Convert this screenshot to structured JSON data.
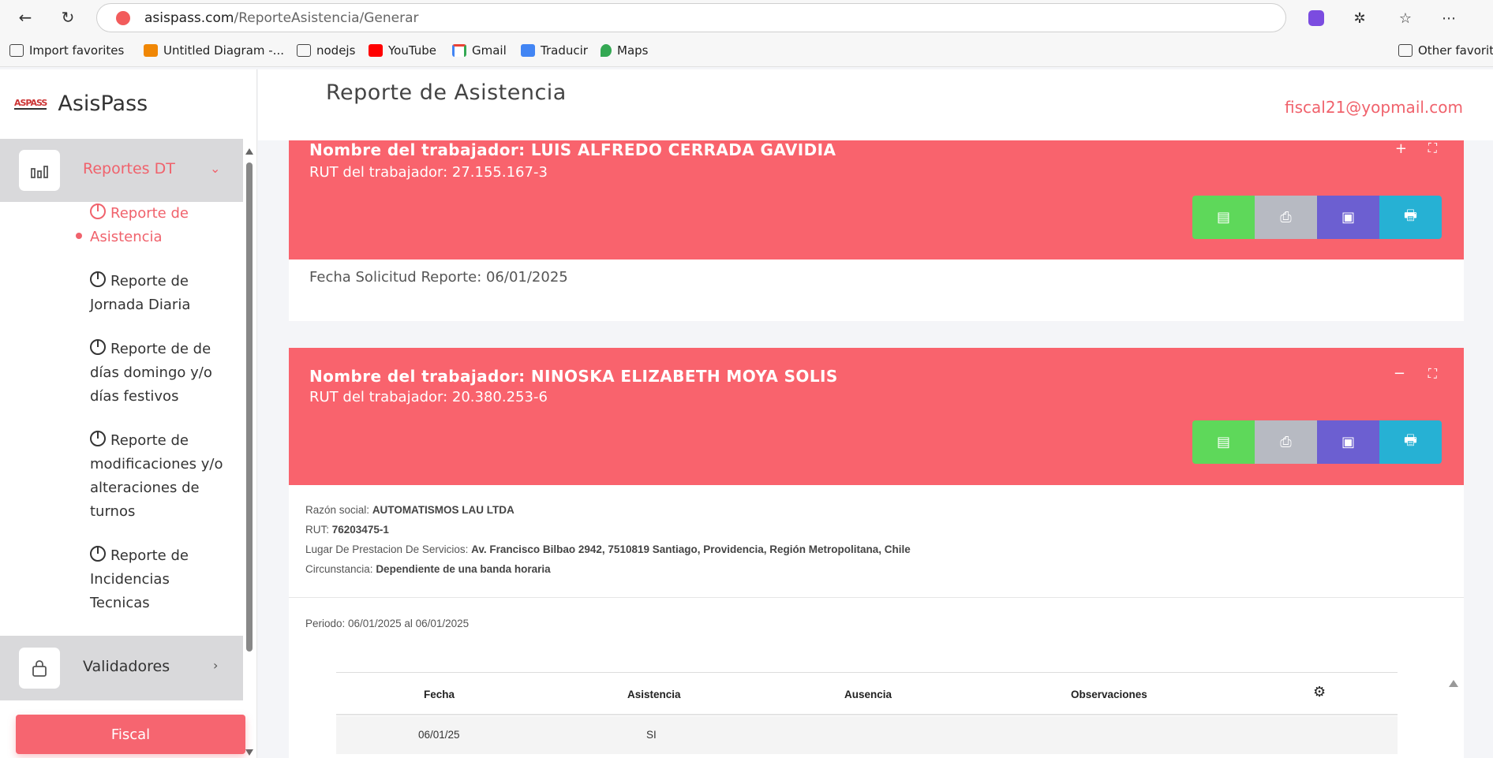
{
  "browser": {
    "url_host": "asispass.com",
    "url_path": "/ReporteAsistencia/Generar",
    "bookmarks": [
      "Import favorites",
      "Untitled Diagram -...",
      "nodejs",
      "YouTube",
      "Gmail",
      "Traducir",
      "Maps"
    ],
    "other_favorites": "Other favorite"
  },
  "sidebar": {
    "logo_mark": "ASPASS",
    "app_name": "AsisPass",
    "reportes_label": "Reportes DT",
    "sub_items": [
      {
        "label": "Reporte de Asistencia"
      },
      {
        "label": "Reporte de Jornada Diaria"
      },
      {
        "label": "Reporte de de días domingo y/o días festivos"
      },
      {
        "label": "Reporte de modificaciones y/o alteraciones de turnos"
      },
      {
        "label": "Reporte de Incidencias Tecnicas"
      }
    ],
    "validadores_label": "Validadores",
    "fiscal_button": "Fiscal"
  },
  "header": {
    "title": "Reporte de Asistencia",
    "user_email": "fiscal21@yopmail.com"
  },
  "cards": [
    {
      "worker_name": "Nombre del trabajador: LUIS ALFREDO CERRADA GAVIDIA",
      "worker_rut": "RUT del trabajador: 27.155.167-3",
      "toggle": "+",
      "fecha_solicitud": "Fecha Solicitud Reporte: 06/01/2025"
    },
    {
      "worker_name": "Nombre del trabajador: NINOSKA ELIZABETH MOYA SOLIS",
      "worker_rut": "RUT del trabajador: 20.380.253-6",
      "toggle": "−",
      "razon_social_label": "Razón social:",
      "razon_social": "AUTOMATISMOS LAU LTDA",
      "rut_label": "RUT:",
      "rut": "76203475-1",
      "lugar_label": "Lugar De Prestacion De Servicios:",
      "lugar": "Av. Francisco Bilbao 2942, 7510819 Santiago, Providencia, Región Metropolitana, Chile",
      "circunstancia_label": "Circunstancia:",
      "circunstancia": "Dependiente de una banda horaria",
      "periodo": "Periodo: 06/01/2025 al 06/01/2025",
      "table": {
        "headers": [
          "Fecha",
          "Asistencia",
          "Ausencia",
          "Observaciones"
        ],
        "rows": [
          {
            "fecha": "06/01/25",
            "asistencia": "SI",
            "ausencia": "",
            "observaciones": ""
          }
        ]
      }
    }
  ],
  "colors": {
    "accent": "#f0626c",
    "card_header": "#f9636d",
    "btn_excel": "#5ed85a",
    "btn_pdf": "#b7bac2",
    "btn_doc": "#6c5fd1",
    "btn_print": "#26b1d4"
  },
  "icons": {
    "excel": "excel-icon",
    "pdf": "pdf-icon",
    "doc": "document-icon",
    "print": "print-icon"
  }
}
